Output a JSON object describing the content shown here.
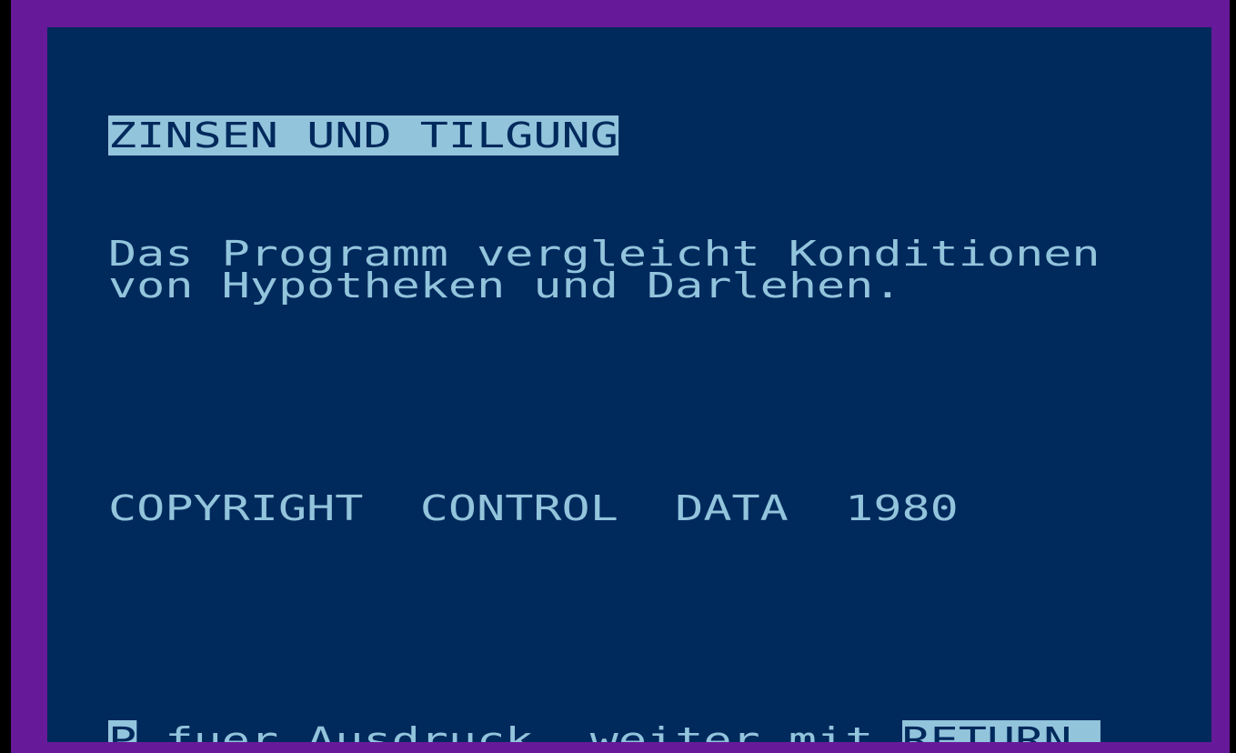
{
  "screen": {
    "program_title": "ZINSEN UND TILGUNG",
    "description_line1": "Das Programm vergleicht Konditionen",
    "description_line2": "von Hypotheken und Darlehen.",
    "copyright_line": "COPYRIGHT  CONTROL  DATA  1980",
    "status": {
      "print_key": "P",
      "print_hint": " fuer Ausdruck ,weiter mit ",
      "continue_key": "RETURN "
    }
  },
  "colors": {
    "border_purple": "#661A99",
    "screen_background": "#00295C",
    "text_foreground": "#92C4DC",
    "inverse_background": "#92C4DC",
    "inverse_foreground": "#00295C",
    "outer_black": "#000000"
  }
}
